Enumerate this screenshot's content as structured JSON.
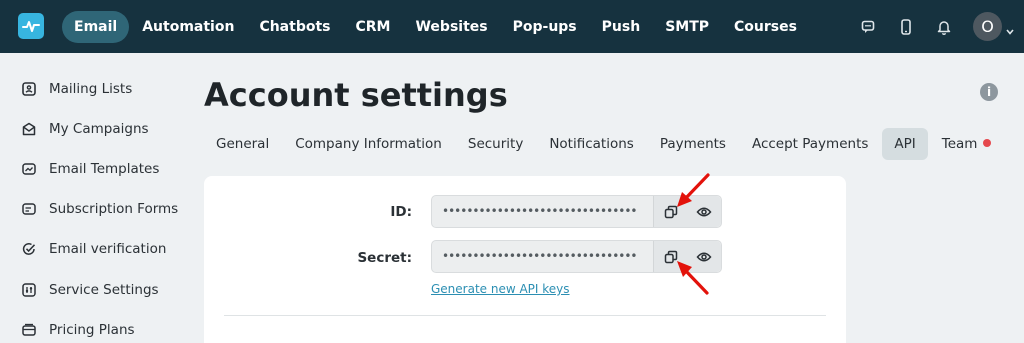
{
  "app": {
    "avatar_letter": "O"
  },
  "nav": {
    "items": [
      {
        "label": "Email",
        "active": true
      },
      {
        "label": "Automation"
      },
      {
        "label": "Chatbots"
      },
      {
        "label": "CRM"
      },
      {
        "label": "Websites"
      },
      {
        "label": "Pop-ups"
      },
      {
        "label": "Push"
      },
      {
        "label": "SMTP"
      },
      {
        "label": "Courses"
      }
    ],
    "right_icons": [
      "chat-icon",
      "mobile-icon",
      "bell-icon"
    ]
  },
  "sidebar": {
    "items": [
      {
        "label": "Mailing Lists",
        "icon": "mailing-list-icon"
      },
      {
        "label": "My Campaigns",
        "icon": "campaigns-icon"
      },
      {
        "label": "Email Templates",
        "icon": "templates-icon"
      },
      {
        "label": "Subscription Forms",
        "icon": "forms-icon"
      },
      {
        "label": "Email verification",
        "icon": "verify-icon"
      },
      {
        "label": "Service Settings",
        "icon": "settings-icon"
      },
      {
        "label": "Pricing Plans",
        "icon": "pricing-icon"
      }
    ]
  },
  "main": {
    "title": "Account settings",
    "tabs": [
      {
        "label": "General"
      },
      {
        "label": "Company Information"
      },
      {
        "label": "Security"
      },
      {
        "label": "Notifications"
      },
      {
        "label": "Payments"
      },
      {
        "label": "Accept Payments"
      },
      {
        "label": "API",
        "active": true
      },
      {
        "label": "Team",
        "badge": true
      }
    ],
    "fields": {
      "id": {
        "label": "ID:",
        "value": "••••••••••••••••••••••••••••••••"
      },
      "secret": {
        "label": "Secret:",
        "value": "••••••••••••••••••••••••••••••••"
      }
    },
    "generate_link": "Generate new API keys"
  },
  "colors": {
    "topbar": "#16323f",
    "accent": "#2c8fb3",
    "active_nav": "#2f6677",
    "annotation_arrow": "#e3120b"
  }
}
